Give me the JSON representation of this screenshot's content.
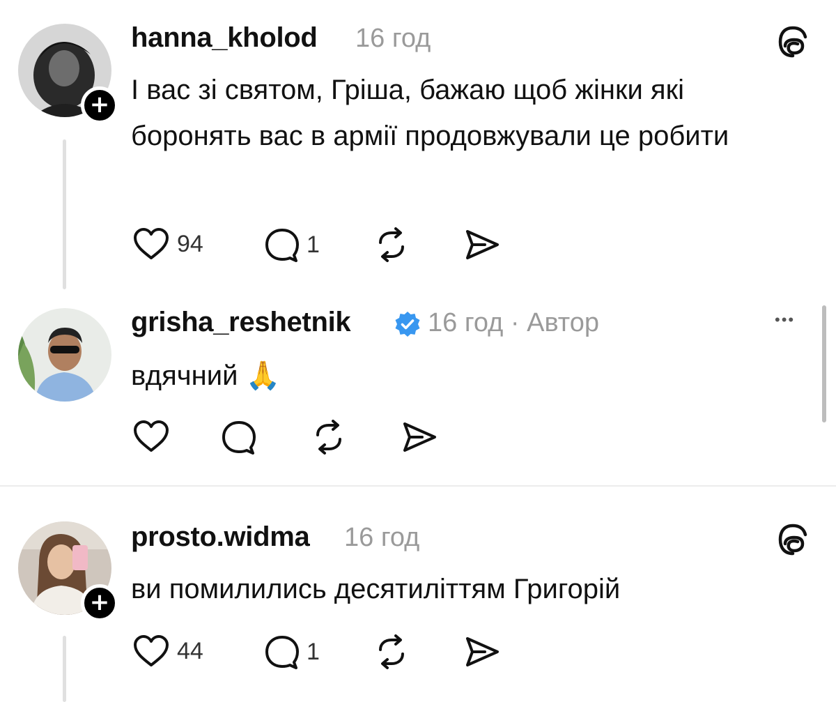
{
  "comments": [
    {
      "username": "hanna_kholod",
      "time": "16 год",
      "text": "І вас зі святом, Гріша, бажаю щоб жінки які боронять вас в армії продовжували це робити",
      "likes": "94",
      "replies": "1"
    },
    {
      "username": "grisha_reshetnik",
      "time": "16 год · Автор",
      "text": "вдячний 🙏"
    },
    {
      "username": "prosto.widma",
      "time": "16 год",
      "text": "ви помилились десятиліттям Григорій",
      "likes": "44",
      "replies": "1"
    }
  ],
  "icons": {
    "badge": "+",
    "more": "•••"
  },
  "colors": {
    "verified": "#3897f0",
    "muted": "#9a9a9a"
  }
}
